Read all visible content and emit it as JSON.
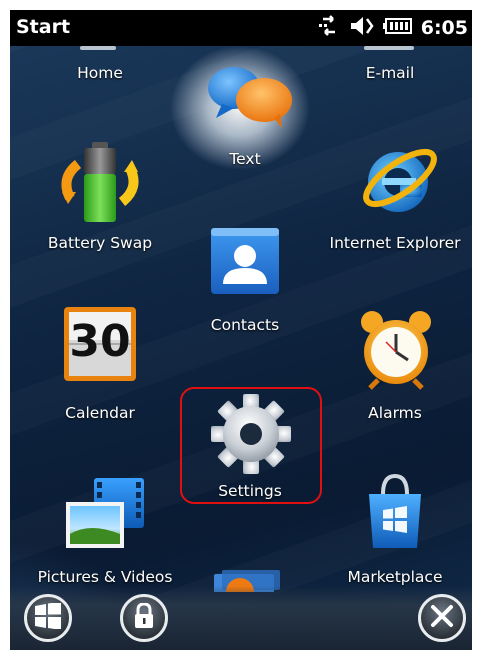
{
  "statusbar": {
    "title": "Start",
    "time": "6:05",
    "icons": [
      "data-sync-icon",
      "volume-icon",
      "battery-icon"
    ]
  },
  "apps": {
    "home": "Home",
    "email": "E-mail",
    "text": "Text",
    "battery_swap": "Battery Swap",
    "internet_explorer": "Internet Explorer",
    "contacts": "Contacts",
    "calendar": "Calendar",
    "calendar_day": "30",
    "alarms": "Alarms",
    "settings": "Settings",
    "pictures_videos": "Pictures & Videos",
    "marketplace": "Marketplace"
  },
  "bottombar": {
    "buttons": [
      "windows-start-icon",
      "lock-icon",
      "close-icon"
    ]
  },
  "colors": {
    "highlight": "#e01010",
    "background": "#0e2440"
  }
}
